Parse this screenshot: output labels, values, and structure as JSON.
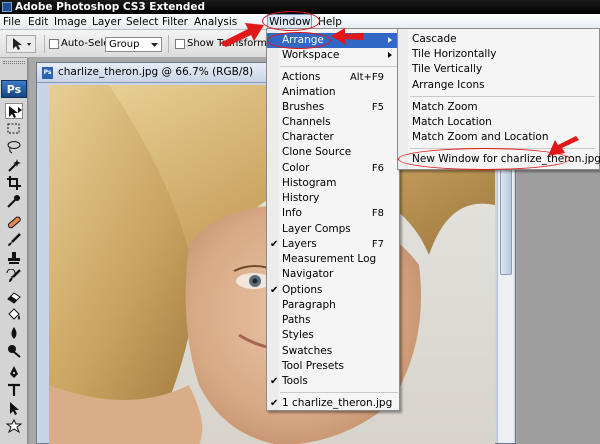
{
  "app": {
    "title": "Adobe Photoshop CS3 Extended"
  },
  "menubar": {
    "items": [
      "File",
      "Edit",
      "Image",
      "Layer",
      "Select",
      "Filter",
      "Analysis",
      "Window",
      "Help"
    ]
  },
  "options_bar": {
    "auto_select_label": "Auto-Select:",
    "auto_select_checked": false,
    "group_value": "Group",
    "show_transform_label": "Show Transform Con",
    "show_transform_checked": false
  },
  "toolbox": {
    "logo": "Ps",
    "tools": [
      "move-tool-icon",
      "marquee-tool-icon",
      "lasso-tool-icon",
      "magic-wand-tool-icon",
      "crop-tool-icon",
      "eyedropper-tool-icon",
      "healing-brush-tool-icon",
      "brush-tool-icon",
      "clone-stamp-tool-icon",
      "history-brush-tool-icon",
      "eraser-tool-icon",
      "paint-bucket-tool-icon",
      "blur-tool-icon",
      "dodge-tool-icon",
      "pen-tool-icon",
      "type-tool-icon",
      "path-selection-tool-icon",
      "shape-tool-icon"
    ]
  },
  "document": {
    "title": "charlize_theron.jpg @ 66.7% (RGB/8)",
    "icon_label": "Ps"
  },
  "window_menu": {
    "items": [
      {
        "label": "Arrange",
        "submenu": true,
        "highlighted": true
      },
      {
        "label": "Workspace",
        "submenu": true
      },
      {
        "label": "Actions",
        "shortcut": "Alt+F9"
      },
      {
        "label": "Animation"
      },
      {
        "label": "Brushes",
        "shortcut": "F5"
      },
      {
        "label": "Channels"
      },
      {
        "label": "Character"
      },
      {
        "label": "Clone Source"
      },
      {
        "label": "Color",
        "shortcut": "F6"
      },
      {
        "label": "Histogram"
      },
      {
        "label": "History"
      },
      {
        "label": "Info",
        "shortcut": "F8"
      },
      {
        "label": "Layer Comps"
      },
      {
        "label": "Layers",
        "shortcut": "F7",
        "checked": true
      },
      {
        "label": "Measurement Log"
      },
      {
        "label": "Navigator"
      },
      {
        "label": "Options",
        "checked": true
      },
      {
        "label": "Paragraph"
      },
      {
        "label": "Paths"
      },
      {
        "label": "Styles"
      },
      {
        "label": "Swatches"
      },
      {
        "label": "Tool Presets"
      },
      {
        "label": "Tools",
        "checked": true
      },
      {
        "label": "1 charlize_theron.jpg",
        "checked": true
      }
    ]
  },
  "arrange_submenu": {
    "items": [
      {
        "label": "Cascade"
      },
      {
        "label": "Tile Horizontally"
      },
      {
        "label": "Tile Vertically"
      },
      {
        "label": "Arrange Icons"
      },
      {
        "label": "Match Zoom"
      },
      {
        "label": "Match Location"
      },
      {
        "label": "Match Zoom and Location"
      },
      {
        "label": "New Window for charlize_theron.jpg"
      }
    ]
  },
  "colors": {
    "menu_highlight": "#3168c7",
    "annotation_red": "#e01818",
    "title_bar": "#000000"
  }
}
